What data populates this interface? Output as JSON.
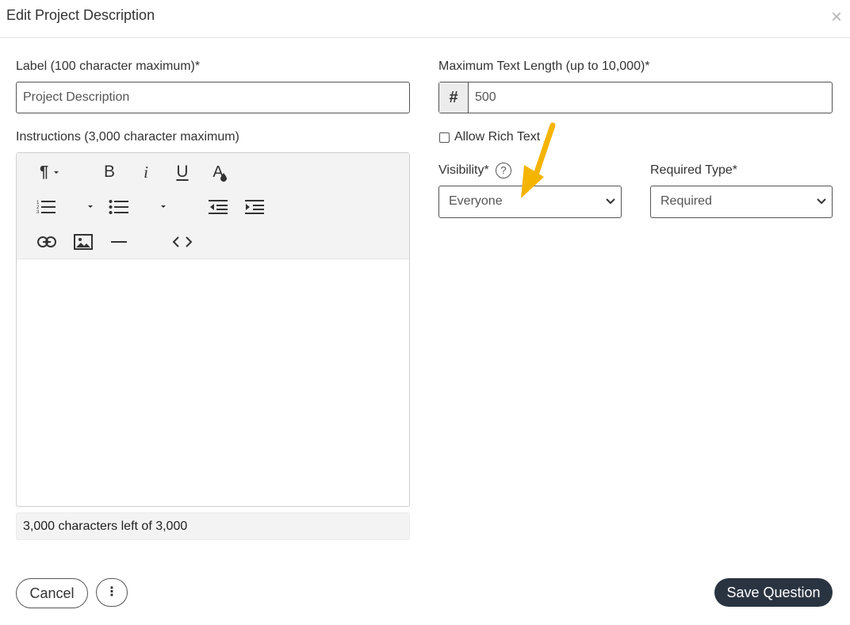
{
  "dialog": {
    "title": "Edit Project Description",
    "close_glyph": "×"
  },
  "label_field": {
    "label": "Label (100 character maximum)*",
    "value": "Project Description"
  },
  "instructions": {
    "label": "Instructions (3,000 character maximum)",
    "counter": "3,000 characters left of 3,000",
    "toolbar_icons": [
      "paragraph-icon",
      "bold-icon",
      "italic-icon",
      "underline-icon",
      "text-color-icon",
      "ordered-list-icon",
      "unordered-list-icon",
      "outdent-icon",
      "indent-icon",
      "link-icon",
      "image-icon",
      "horizontal-rule-icon",
      "code-view-icon"
    ],
    "bold_glyph": "B",
    "italic_glyph": "i",
    "underline_glyph": "U",
    "paragraph_glyph": "¶",
    "color_glyph": "A"
  },
  "max_length": {
    "label": "Maximum Text Length (up to 10,000)*",
    "prefix": "#",
    "value": "500"
  },
  "rich_text": {
    "label": "Allow Rich Text",
    "checked": false
  },
  "visibility": {
    "label": "Visibility*",
    "help_glyph": "?",
    "selected": "Everyone"
  },
  "required_type": {
    "label": "Required Type*",
    "selected": "Required"
  },
  "footer": {
    "cancel": "Cancel",
    "more_glyph": "⋮",
    "save": "Save Question"
  },
  "colors": {
    "save_bg": "#2a3441",
    "arrow": "#f5b400",
    "toolbar_bg": "#f3f3f3"
  }
}
